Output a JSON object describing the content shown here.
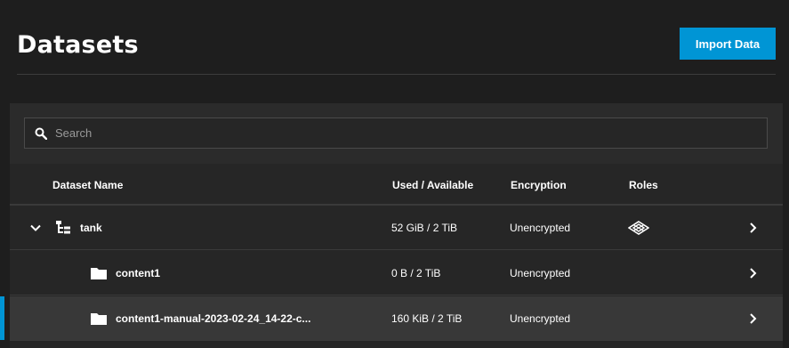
{
  "header": {
    "title": "Datasets",
    "import_button_label": "Import Data"
  },
  "search": {
    "placeholder": "Search",
    "value": ""
  },
  "table": {
    "columns": {
      "name": "Dataset Name",
      "used": "Used / Available",
      "encryption": "Encryption",
      "roles": "Roles"
    },
    "rows": [
      {
        "name": "tank",
        "used": "52 GiB / 2 TiB",
        "encryption": "Unencrypted",
        "icon": "pool-tree-icon",
        "expanded": true,
        "role_icon": "share-roles-icon"
      },
      {
        "name": "content1",
        "used": "0 B / 2 TiB",
        "encryption": "Unencrypted",
        "icon": "folder-icon"
      },
      {
        "name": "content1-manual-2023-02-24_14-22-c...",
        "used": "160 KiB / 2 TiB",
        "encryption": "Unencrypted",
        "icon": "folder-icon",
        "selected": true
      }
    ]
  },
  "colors": {
    "accent": "#0095d5",
    "background": "#1e1e1e",
    "card": "#262626",
    "selected_row": "#383838"
  }
}
